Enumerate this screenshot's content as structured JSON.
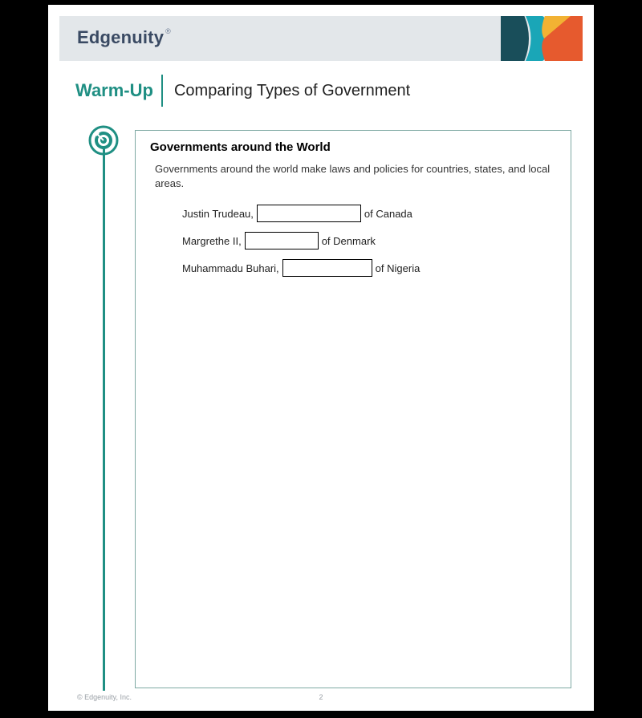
{
  "brand": {
    "name": "Edgenuity",
    "mark": "®"
  },
  "section": {
    "label": "Warm-Up",
    "topic": "Comparing Types of Government"
  },
  "content": {
    "heading": "Governments around the World",
    "intro": "Governments around the world make laws and policies for countries, states, and local areas.",
    "fill_items": [
      {
        "before": "Justin Trudeau,",
        "value": "",
        "after": "of Canada"
      },
      {
        "before": "Margrethe II,",
        "value": "",
        "after": "of Denmark"
      },
      {
        "before": "Muhammadu Buhari,",
        "value": "",
        "after": "of Nigeria"
      }
    ]
  },
  "footer": {
    "copyright": "© Edgenuity, Inc.",
    "page_number": "2"
  }
}
